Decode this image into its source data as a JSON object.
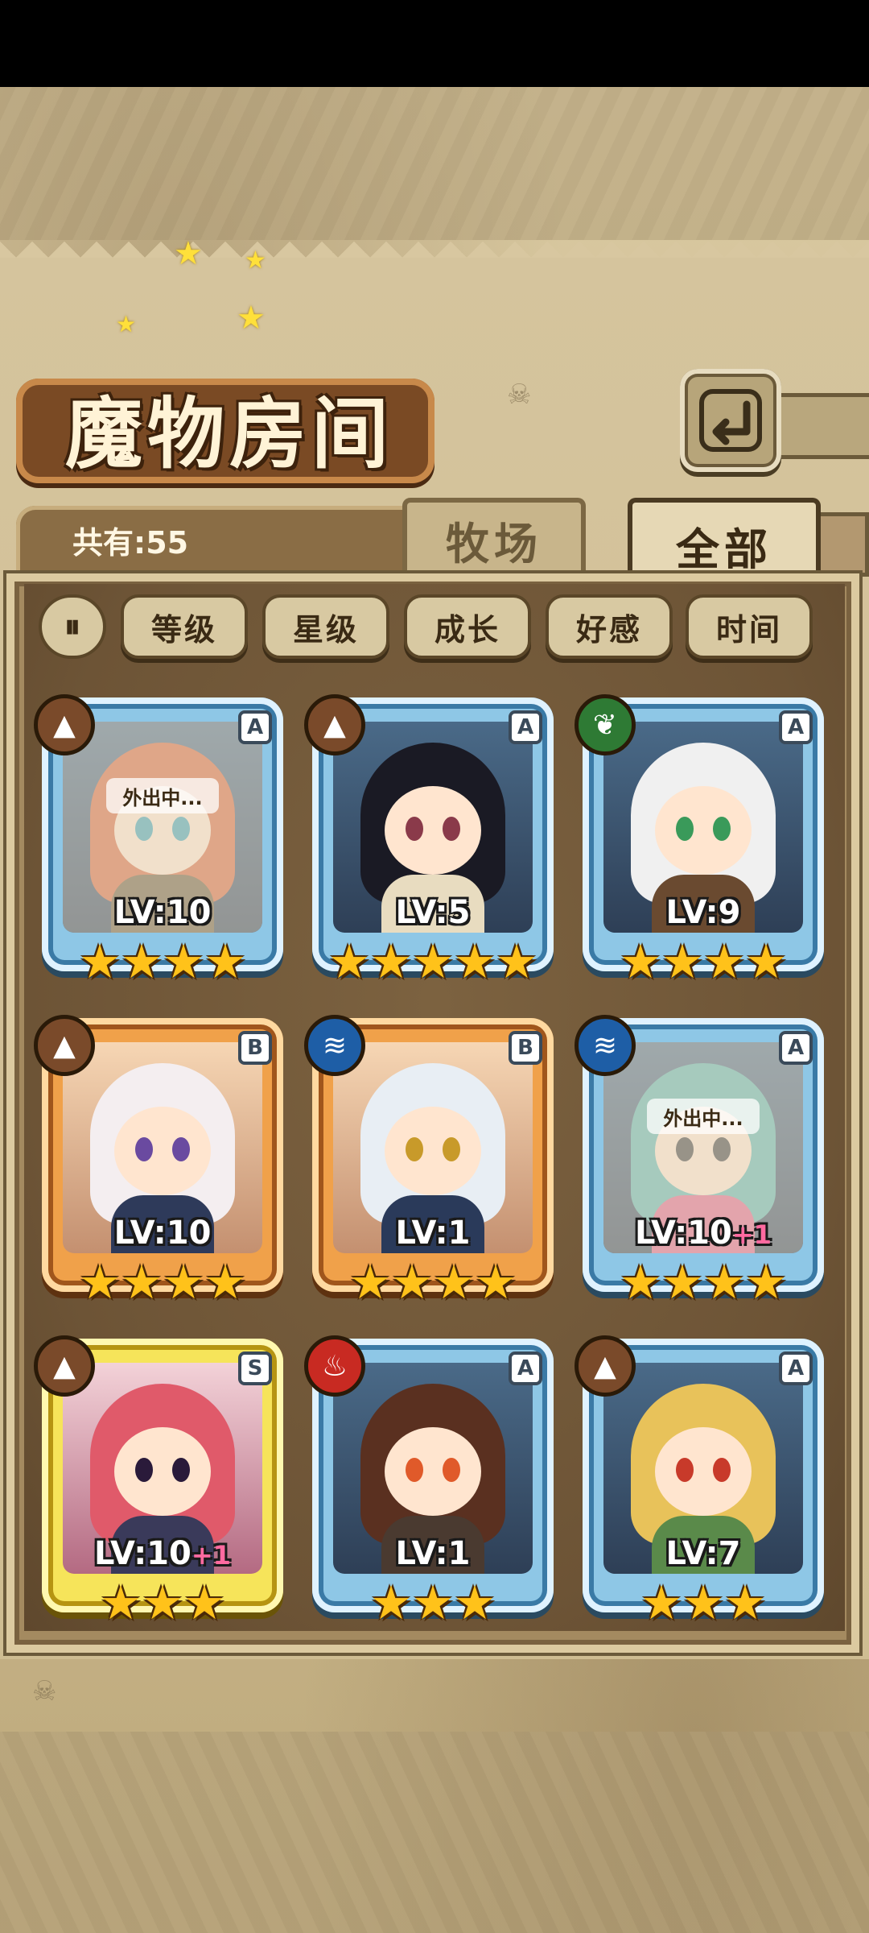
{
  "header": {
    "title": "魔物房间",
    "back_icon": "return-arrow-icon"
  },
  "summary": {
    "count_text": "共有:55"
  },
  "tabs": [
    {
      "label": "牧场",
      "active": false
    },
    {
      "label": "全部",
      "active": true
    }
  ],
  "sort_bar": {
    "toggle_icon": "pause-toggle-icon",
    "buttons": [
      {
        "label": "等级"
      },
      {
        "label": "星级"
      },
      {
        "label": "成长"
      },
      {
        "label": "好感"
      },
      {
        "label": "时间"
      }
    ]
  },
  "monsters": [
    {
      "element": "earth",
      "rank": "A",
      "level": "LV:10",
      "bonus": "",
      "stars": 4,
      "away": true,
      "away_text": "外出中...",
      "hair": "#d8643a",
      "body": "#6a5a3a",
      "eye": "#3aa0b4"
    },
    {
      "element": "earth",
      "rank": "A",
      "level": "LV:5",
      "bonus": "",
      "stars": 5,
      "away": false,
      "away_text": "",
      "hair": "#1a1a24",
      "body": "#e8dcc0",
      "eye": "#8a3a4a"
    },
    {
      "element": "wind",
      "rank": "A",
      "level": "LV:9",
      "bonus": "",
      "stars": 4,
      "away": false,
      "away_text": "",
      "hair": "#f0f0f0",
      "body": "#6a4a30",
      "eye": "#3a9a5a"
    },
    {
      "element": "earth",
      "rank": "B",
      "level": "LV:10",
      "bonus": "",
      "stars": 4,
      "away": false,
      "away_text": "",
      "hair": "#f4eef0",
      "body": "#2e3a5a",
      "eye": "#6a4aa0"
    },
    {
      "element": "water",
      "rank": "B",
      "level": "LV:1",
      "bonus": "",
      "stars": 4,
      "away": false,
      "away_text": "",
      "hair": "#e8eef4",
      "body": "#2a3a5a",
      "eye": "#c89a2a"
    },
    {
      "element": "water",
      "rank": "A",
      "level": "LV:10",
      "bonus": "+1",
      "stars": 4,
      "away": true,
      "away_text": "外出中...",
      "hair": "#5ab4b0",
      "body": "#e0608a",
      "eye": "#3a3a3a"
    },
    {
      "element": "earth",
      "rank": "S",
      "level": "LV:10",
      "bonus": "+1",
      "stars": 3,
      "away": false,
      "away_text": "",
      "hair": "#e05a6a",
      "body": "#3a3a5a",
      "eye": "#2a1a3a"
    },
    {
      "element": "fire",
      "rank": "A",
      "level": "LV:1",
      "bonus": "",
      "stars": 3,
      "away": false,
      "away_text": "",
      "hair": "#5a3020",
      "body": "#4a3a30",
      "eye": "#e05a2a"
    },
    {
      "element": "earth",
      "rank": "A",
      "level": "LV:7",
      "bonus": "",
      "stars": 3,
      "away": false,
      "away_text": "",
      "hair": "#e8c25a",
      "body": "#5a8a4a",
      "eye": "#c83a2a"
    }
  ]
}
